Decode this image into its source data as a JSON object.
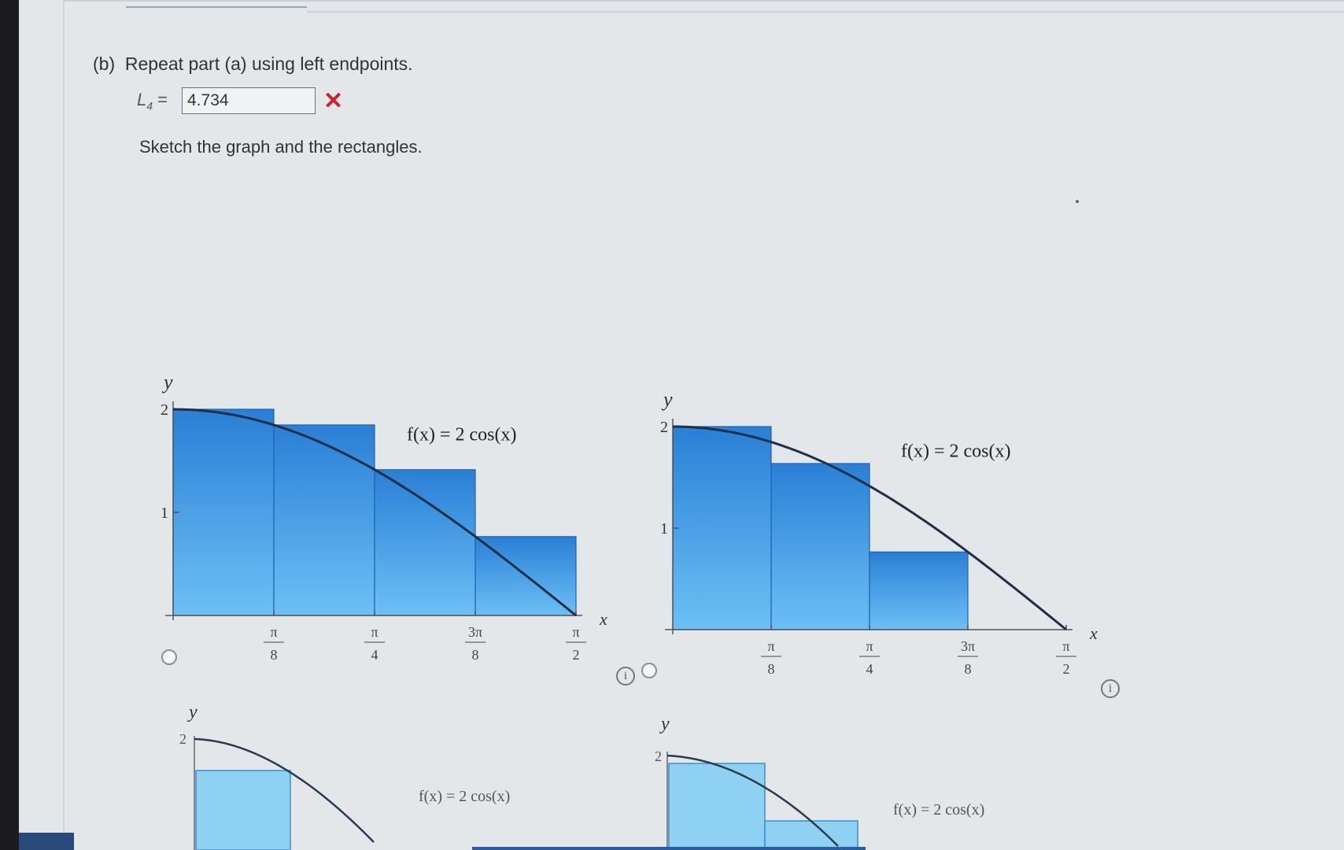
{
  "question": {
    "part_label": "(b)",
    "prompt": "Repeat part (a) using left endpoints.",
    "answer_label": "L",
    "answer_subscript": "4",
    "answer_equals": "=",
    "answer_value": "4.734",
    "answer_status": "incorrect",
    "instruction": "Sketch the graph and the rectangles."
  },
  "graph_options": [
    {
      "id": "option-1",
      "function_label": "f(x) = 2 cos(x)",
      "y_axis_label": "y",
      "x_axis_label": "x",
      "y_ticks": [
        "1",
        "2"
      ],
      "x_ticks": [
        {
          "num": "π",
          "den": "8"
        },
        {
          "num": "π",
          "den": "4"
        },
        {
          "num": "3π",
          "den": "8"
        },
        {
          "num": "π",
          "den": "2"
        }
      ]
    },
    {
      "id": "option-2",
      "function_label": "f(x) = 2 cos(x)",
      "y_axis_label": "y",
      "x_axis_label": "x",
      "y_ticks": [
        "1",
        "2"
      ],
      "x_ticks": [
        {
          "num": "π",
          "den": "8"
        },
        {
          "num": "π",
          "den": "4"
        },
        {
          "num": "3π",
          "den": "8"
        },
        {
          "num": "π",
          "den": "2"
        }
      ]
    },
    {
      "id": "option-3",
      "function_label": "f(x) = 2 cos(x)",
      "y_axis_label": "y",
      "y_ticks": [
        "2"
      ]
    },
    {
      "id": "option-4",
      "function_label": "f(x) = 2 cos(x)",
      "y_axis_label": "y",
      "y_ticks": [
        "2"
      ]
    }
  ],
  "chart_data": [
    {
      "type": "bar",
      "function": "2cos(x)",
      "x_range": [
        0,
        1.5708
      ],
      "ylim": [
        0,
        2
      ],
      "rectangles": [
        {
          "x0": 0,
          "x1": 0.3927,
          "height": 2.0
        },
        {
          "x0": 0.3927,
          "x1": 0.7854,
          "height": 1.848
        },
        {
          "x0": 0.7854,
          "x1": 1.1781,
          "height": 1.414
        },
        {
          "x0": 1.1781,
          "x1": 1.5708,
          "height": 0.765
        }
      ]
    },
    {
      "type": "bar",
      "function": "2cos(x)",
      "x_range": [
        0,
        1.5708
      ],
      "ylim": [
        0,
        2
      ],
      "rectangles": [
        {
          "x0": 0,
          "x1": 0.3927,
          "height": 2.0
        },
        {
          "x0": 0.3927,
          "x1": 0.7854,
          "height": 1.636
        },
        {
          "x0": 0.7854,
          "x1": 1.1781,
          "height": 0.765
        },
        {
          "x0": 1.1781,
          "x1": 1.5708,
          "height": 0
        }
      ]
    }
  ],
  "colors": {
    "answer_wrong": "#d0202a",
    "rect_top": "#2a7fd6",
    "rect_bottom": "#6cc0f5",
    "curve": "#1f2f45",
    "rect_light": "#8fd1f3"
  }
}
